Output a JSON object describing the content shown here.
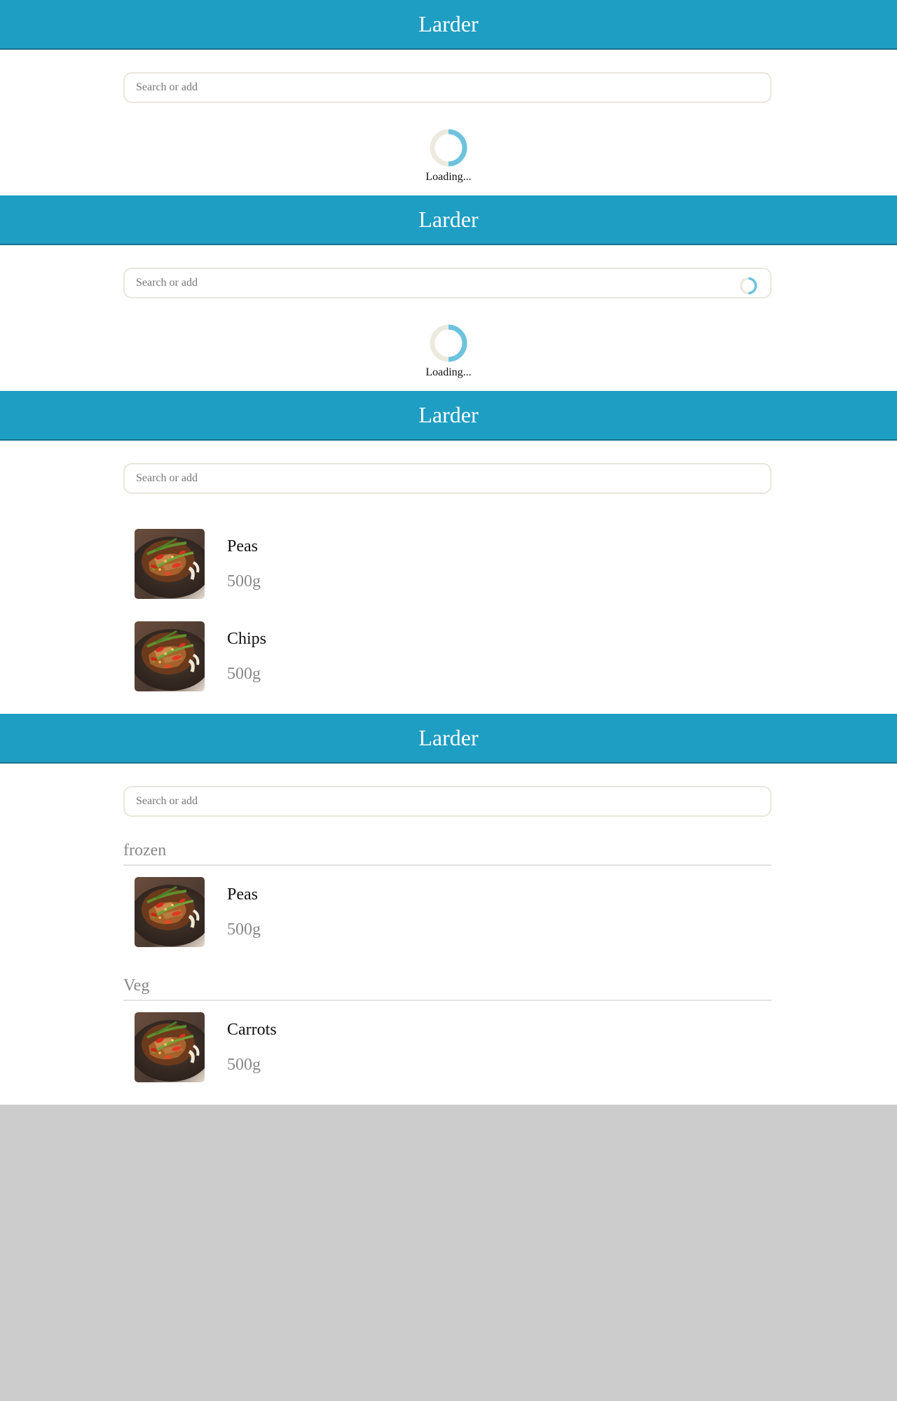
{
  "app": {
    "title": "Larder"
  },
  "search": {
    "placeholder": "Search or add"
  },
  "loading": {
    "text": "Loading..."
  },
  "screens": {
    "s3": {
      "items": [
        {
          "name": "Peas",
          "quantity": "500g",
          "image": "stir-fry-dish"
        },
        {
          "name": "Chips",
          "quantity": "500g",
          "image": "stir-fry-dish"
        }
      ]
    },
    "s4": {
      "groups": [
        {
          "label": "frozen",
          "items": [
            {
              "name": "Peas",
              "quantity": "500g",
              "image": "stir-fry-dish"
            }
          ]
        },
        {
          "label": "Veg",
          "items": [
            {
              "name": "Carrots",
              "quantity": "500g",
              "image": "stir-fry-dish"
            }
          ]
        }
      ]
    }
  },
  "colors": {
    "header": "#1f9ec3",
    "header_border": "#176f8c",
    "spinner_accent": "#6dc3dd",
    "spinner_track": "#ece9df",
    "backdrop": "#cccccc"
  },
  "icons": {
    "loading": "spinner-icon",
    "thumbnail": "food-thumbnail"
  }
}
